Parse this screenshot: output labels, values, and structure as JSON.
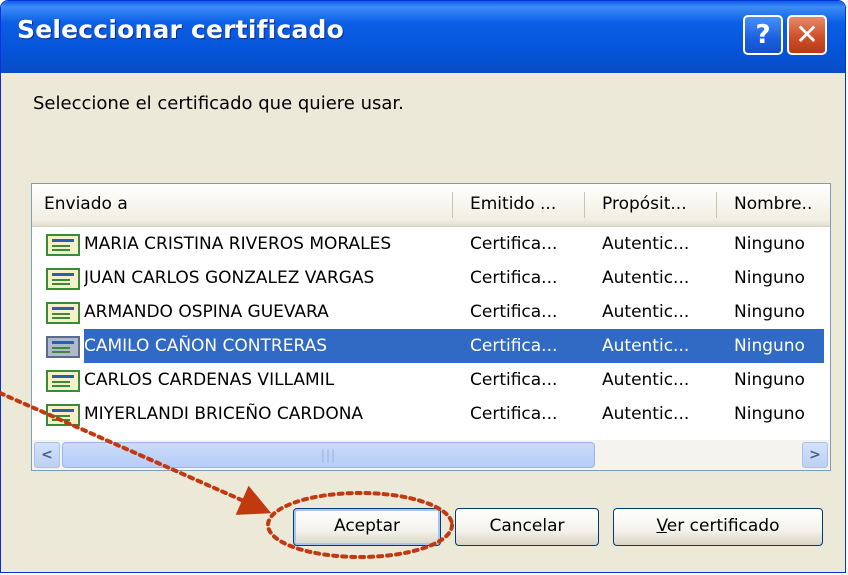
{
  "window": {
    "title": "Seleccionar certificado",
    "help_glyph": "?",
    "close_glyph": "✕"
  },
  "prompt": "Seleccione el certificado que quiere usar.",
  "columns": [
    "Enviado a",
    "Emitido ...",
    "Propósit...",
    "Nombre.."
  ],
  "rows": [
    {
      "name": "MARIA CRISTINA RIVEROS MORALES",
      "issued_by": "Certifica...",
      "purpose": "Autentic...",
      "friendly": "Ninguno"
    },
    {
      "name": "JUAN CARLOS GONZALEZ VARGAS",
      "issued_by": "Certifica...",
      "purpose": "Autentic...",
      "friendly": "Ninguno"
    },
    {
      "name": "ARMANDO OSPINA GUEVARA",
      "issued_by": "Certifica...",
      "purpose": "Autentic...",
      "friendly": "Ninguno"
    },
    {
      "name": "CAMILO CAÑON CONTRERAS",
      "issued_by": "Certifica...",
      "purpose": "Autentic...",
      "friendly": "Ninguno"
    },
    {
      "name": "CARLOS CARDENAS VILLAMIL",
      "issued_by": "Certifica...",
      "purpose": "Autentic...",
      "friendly": "Ninguno"
    },
    {
      "name": "MIYERLANDI BRICEÑO CARDONA",
      "issued_by": "Certifica...",
      "purpose": "Autentic...",
      "friendly": "Ninguno"
    }
  ],
  "selected_row": 3,
  "scrollbar": {
    "left_arrow": "<",
    "right_arrow": ">",
    "grip": "|||"
  },
  "buttons": {
    "accept": "Aceptar",
    "cancel": "Cancelar",
    "view_prefix": "V",
    "view_rest": "er certificado"
  },
  "annotation_color": "#c0390f",
  "icons": {
    "certificate": "certificate-icon",
    "help": "help-icon",
    "close": "close-icon"
  }
}
